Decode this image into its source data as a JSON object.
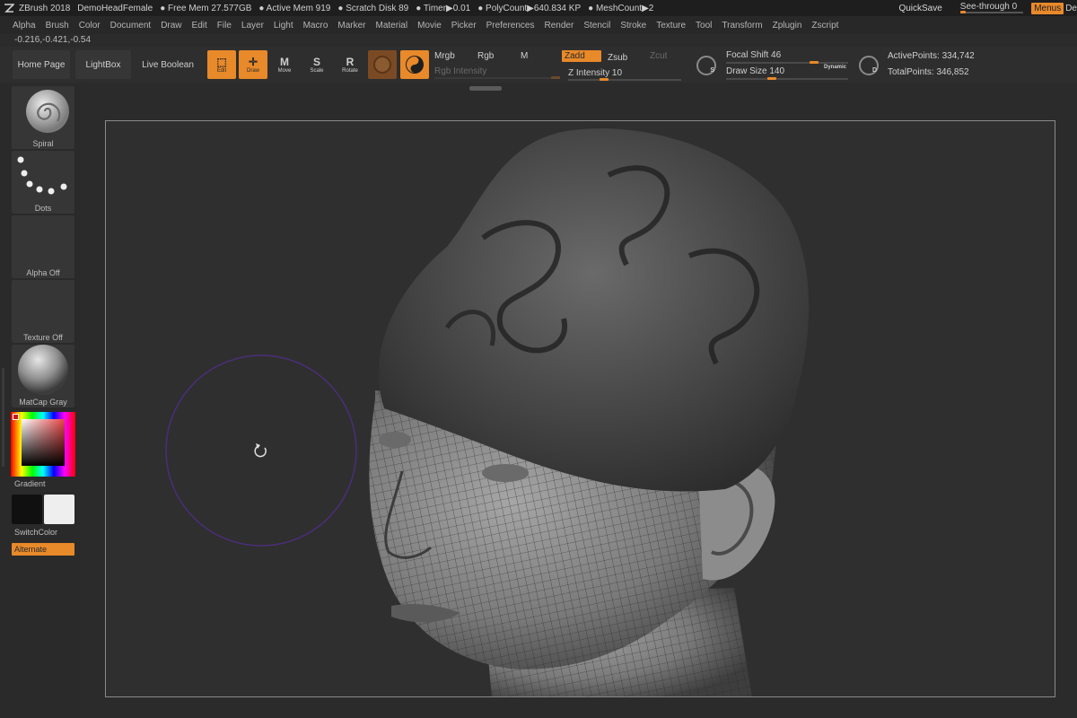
{
  "titlebar": {
    "app": "ZBrush 2018",
    "project": "DemoHeadFemale",
    "free_mem": "● Free Mem 27.577GB",
    "active_mem": "● Active Mem 919",
    "scratch_disk": "● Scratch Disk 89",
    "timer": "● Timer▶0.01",
    "polycount": "● PolyCount▶640.834 KP",
    "meshcount": "● MeshCount▶2",
    "quicksave": "QuickSave",
    "see_through": "See-through  0",
    "see_through_value": 0,
    "menus": "Menus",
    "default_script": "De"
  },
  "menubar": [
    "Alpha",
    "Brush",
    "Color",
    "Document",
    "Draw",
    "Edit",
    "File",
    "Layer",
    "Light",
    "Macro",
    "Marker",
    "Material",
    "Movie",
    "Picker",
    "Preferences",
    "Render",
    "Stencil",
    "Stroke",
    "Texture",
    "Tool",
    "Transform",
    "Zplugin",
    "Zscript"
  ],
  "coords": "-0.216,-0.421,-0.54",
  "shelf": {
    "home_page": "Home Page",
    "lightbox": "LightBox",
    "live_boolean": "Live Boolean",
    "edit": "Edit",
    "draw": "Draw",
    "move": "Move",
    "scale": "Scale",
    "rotate": "Rotate",
    "mrgb": "Mrgb",
    "rgb": "Rgb",
    "m": "M",
    "rgb_intensity": "Rgb Intensity",
    "zadd": "Zadd",
    "zsub": "Zsub",
    "zcut": "Zcut",
    "z_intensity": "Z Intensity 10",
    "z_intensity_value": 10,
    "focal_shift": "Focal Shift 46",
    "focal_shift_value": 46,
    "draw_size": "Draw Size 140",
    "draw_size_value": 140,
    "dynamic": "Dynamic",
    "active_points": "ActivePoints: 334,742",
    "total_points": "TotalPoints: 346,852"
  },
  "tray": {
    "brush": "Spiral",
    "stroke": "Dots",
    "alpha": "Alpha Off",
    "texture": "Texture Off",
    "material": "MatCap Gray",
    "gradient": "Gradient",
    "switch_color": "SwitchColor",
    "alternate": "Alternate"
  },
  "colors": {
    "accent": "#e8892a",
    "background": "#2b2b2b",
    "brush_cursor": "#5a3a8a"
  }
}
